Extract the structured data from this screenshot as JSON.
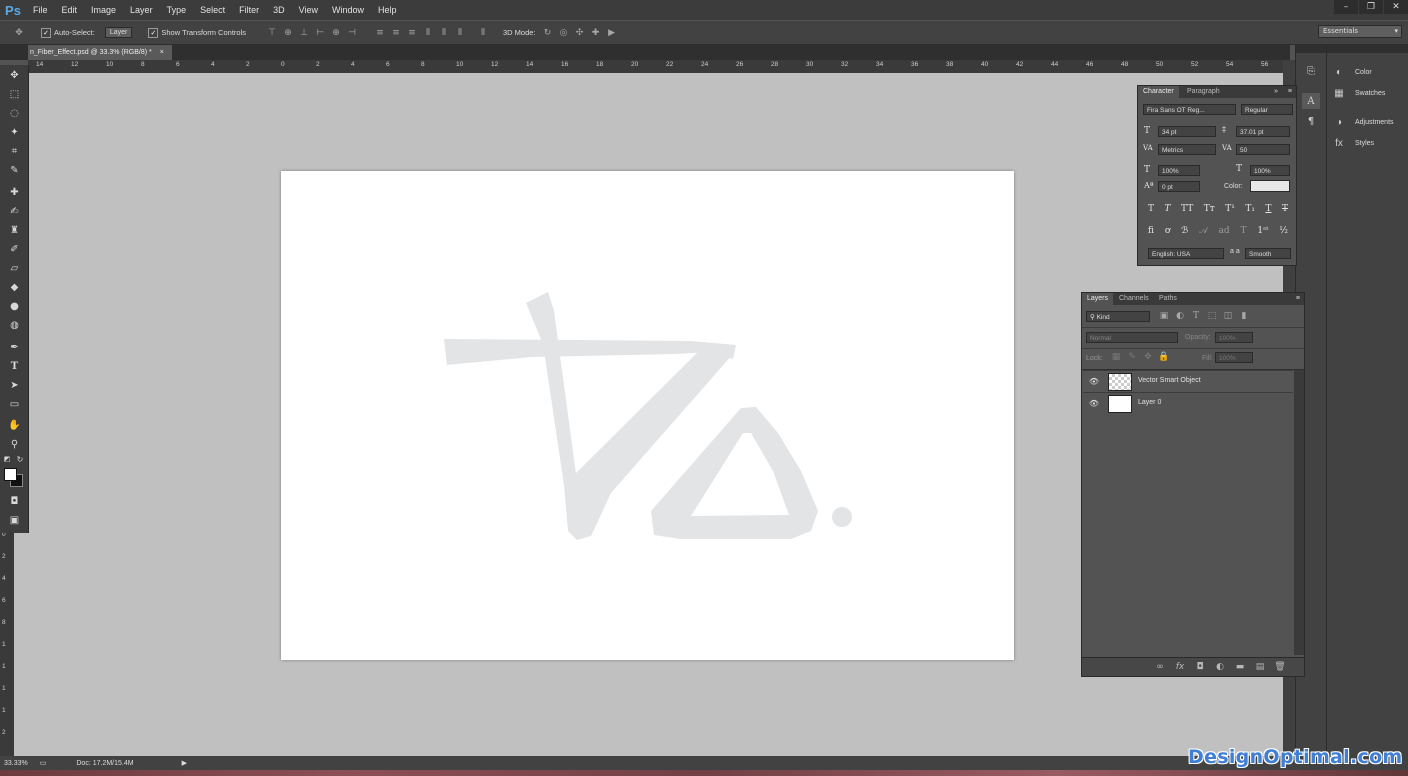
{
  "app": {
    "logo": "Ps"
  },
  "menu": [
    "File",
    "Edit",
    "Image",
    "Layer",
    "Type",
    "Select",
    "Filter",
    "3D",
    "View",
    "Window",
    "Help"
  ],
  "window_controls": {
    "minimize": "–",
    "maximize": "❐",
    "close": "✕"
  },
  "options": {
    "auto_select_label": "Auto-Select:",
    "auto_select_value": "Layer",
    "show_transform_label": "Show Transform Controls",
    "mode_3d_label": "3D Mode:",
    "workspace": "Essentials"
  },
  "document": {
    "tab_title": "n_Fiber_Effect.psd @ 33.3% (RGB/8) *",
    "close": "×"
  },
  "ruler_h": [
    "14",
    "12",
    "10",
    "8",
    "6",
    "4",
    "2",
    "0",
    "2",
    "4",
    "6",
    "8",
    "10",
    "12",
    "14",
    "16",
    "18",
    "20",
    "22",
    "24",
    "26",
    "28",
    "30",
    "32",
    "34",
    "36",
    "38",
    "40",
    "42",
    "44",
    "46",
    "48",
    "50",
    "52",
    "54",
    "56"
  ],
  "ruler_v": [
    "0",
    "2",
    "4",
    "6",
    "8",
    "1",
    "1",
    "1",
    "1",
    "2"
  ],
  "status": {
    "zoom": "33.33%",
    "doc": "Doc: 17.2M/15.4M"
  },
  "dock": {
    "color": "Color",
    "swatches": "Swatches",
    "adjustments": "Adjustments",
    "styles": "Styles"
  },
  "character": {
    "tab_character": "Character",
    "tab_paragraph": "Paragraph",
    "font_family": "Fira Sans OT Reg...",
    "font_style": "Regular",
    "font_size": "34 pt",
    "leading": "37.01 pt",
    "kerning": "Metrics",
    "tracking": "50",
    "vscale": "100%",
    "hscale": "100%",
    "baseline": "0 pt",
    "color_label": "Color:",
    "language": "English: USA",
    "antialias_label": "a a",
    "antialias": "Smooth"
  },
  "layers": {
    "tab_layers": "Layers",
    "tab_channels": "Channels",
    "tab_paths": "Paths",
    "kind": "Kind",
    "blend_mode": "Normal",
    "opacity_label": "Opacity:",
    "opacity_value": "100%",
    "lock_label": "Lock:",
    "fill_label": "Fill:",
    "fill_value": "100%",
    "items": [
      {
        "name": "Vector Smart Object"
      },
      {
        "name": "Layer 0"
      }
    ]
  },
  "watermark": "DesignOptimal.com",
  "colors": {
    "accent": "#3f7fd6",
    "canvas_bg": "#c0c0c0",
    "logo_gray": "#e3e4e6"
  }
}
